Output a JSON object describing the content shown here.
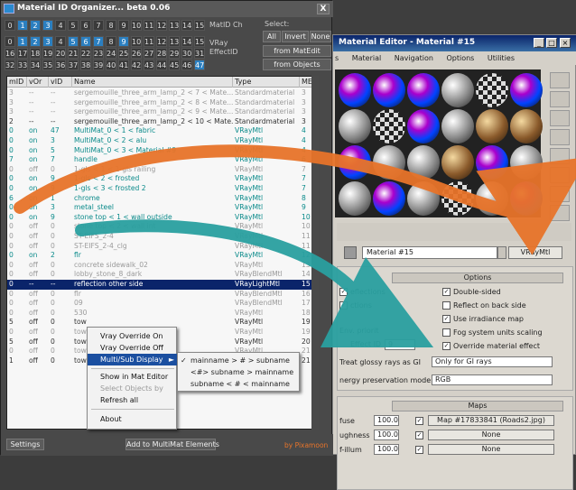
{
  "organizer": {
    "title": "Material ID Organizer...   beta 0.06",
    "close": "X",
    "matid_ch_label": "MatID Ch",
    "vray_label": "VRay",
    "effectid_label": "EffectID",
    "select_label": "Select:",
    "btn_all": "All",
    "btn_invert": "Invert",
    "btn_none": "None",
    "btn_from_matedit": "from MatEdit",
    "btn_from_objects": "from Objects",
    "matid_nums": [
      "0",
      "1",
      "2",
      "3",
      "4",
      "5",
      "6",
      "7",
      "8",
      "9",
      "10",
      "11",
      "12",
      "13",
      "14",
      "15"
    ],
    "matid_active": [
      false,
      true,
      true,
      true,
      false,
      false,
      false,
      false,
      false,
      false,
      false,
      false,
      false,
      false,
      false,
      false
    ],
    "effect_nums_row1": [
      "0",
      "1",
      "2",
      "3",
      "4",
      "5",
      "6",
      "7",
      "8",
      "9",
      "10",
      "11",
      "12",
      "13",
      "14",
      "15"
    ],
    "effect_active_row1": [
      false,
      true,
      true,
      true,
      false,
      true,
      true,
      true,
      false,
      true,
      false,
      false,
      false,
      false,
      false,
      false
    ],
    "effect_nums_row2": [
      "16",
      "17",
      "18",
      "19",
      "20",
      "21",
      "22",
      "23",
      "24",
      "25",
      "26",
      "27",
      "28",
      "29",
      "30",
      "31"
    ],
    "effect_nums_row3": [
      "32",
      "33",
      "34",
      "35",
      "36",
      "37",
      "38",
      "39",
      "40",
      "41",
      "42",
      "43",
      "44",
      "45",
      "46",
      "47"
    ],
    "effect_active_row3": [
      false,
      false,
      false,
      false,
      false,
      false,
      false,
      false,
      false,
      false,
      false,
      false,
      false,
      false,
      false,
      true
    ],
    "columns": [
      "mID",
      "vOr",
      "vID",
      "Name",
      "Type",
      "ME"
    ],
    "rows": [
      {
        "mid": "3",
        "vor": "--",
        "vid": "--",
        "name": "sergemouille_three_arm_lamp_2 < 7 < Mate...",
        "type": "Standardmaterial",
        "me": "3",
        "style": "g"
      },
      {
        "mid": "3",
        "vor": "--",
        "vid": "--",
        "name": "sergemouille_three_arm_lamp_2 < 8 < Mate...",
        "type": "Standardmaterial",
        "me": "3",
        "style": "g"
      },
      {
        "mid": "3",
        "vor": "--",
        "vid": "--",
        "name": "sergemouille_three_arm_lamp_2 < 9 < Mate...",
        "type": "Standardmaterial",
        "me": "3",
        "style": "g"
      },
      {
        "mid": "2",
        "vor": "--",
        "vid": "--",
        "name": "sergemouille_three_arm_lamp_2 < 10 < Mate...",
        "type": "Standardmaterial",
        "me": "3",
        "style": "b"
      },
      {
        "mid": "0",
        "vor": "on",
        "vid": "47",
        "name": "MultiMat_0 < 1 < fabric",
        "type": "VRayMtl",
        "me": "4",
        "style": "t"
      },
      {
        "mid": "0",
        "vor": "on",
        "vid": "3",
        "name": "MultiMat_0 < 2 < alu",
        "type": "VRayMtl",
        "me": "4",
        "style": "t"
      },
      {
        "mid": "0",
        "vor": "on",
        "vid": "5",
        "name": "MultiMat_0 < 3 < Material #9",
        "type": "VRayMtl",
        "me": "4",
        "style": "t"
      },
      {
        "mid": "7",
        "vor": "on",
        "vid": "7",
        "name": "handle",
        "type": "VRayMtl",
        "me": "6",
        "style": "t"
      },
      {
        "mid": "0",
        "vor": "off",
        "vid": "0",
        "name": "1-gls < 1 < 1-gls railing",
        "type": "VRayMtl",
        "me": "7",
        "style": "g"
      },
      {
        "mid": "0",
        "vor": "on",
        "vid": "9",
        "name": "1-gls < 2 < frosted",
        "type": "VRayMtl",
        "me": "7",
        "style": "t"
      },
      {
        "mid": "0",
        "vor": "on",
        "vid": "9",
        "name": "1-gls < 3 < frosted 2",
        "type": "VRayMtl",
        "me": "7",
        "style": "t"
      },
      {
        "mid": "6",
        "vor": "on",
        "vid": "1",
        "name": "chrome",
        "type": "VRayMtl",
        "me": "8",
        "style": "t"
      },
      {
        "mid": "0",
        "vor": "on",
        "vid": "3",
        "name": "metal_steel",
        "type": "VRayMtl",
        "me": "9",
        "style": "t"
      },
      {
        "mid": "0",
        "vor": "on",
        "vid": "9",
        "name": "stone top < 1 < wall outside",
        "type": "VRayMtl",
        "me": "10",
        "style": "t"
      },
      {
        "mid": "0",
        "vor": "off",
        "vid": "0",
        "name": "stone top < 2 < wall int",
        "type": "VRayMtl",
        "me": "10",
        "style": "g"
      },
      {
        "mid": "0",
        "vor": "off",
        "vid": "0",
        "name": "ST-EIFS_2-4",
        "type": "VRayMtl",
        "me": "11",
        "style": "g"
      },
      {
        "mid": "0",
        "vor": "off",
        "vid": "0",
        "name": "ST-EIFS_2-4_clg",
        "type": "VRayMtl",
        "me": "11",
        "style": "g"
      },
      {
        "mid": "0",
        "vor": "on",
        "vid": "2",
        "name": "flr",
        "type": "VRayMtl",
        "me": "12",
        "style": "t"
      },
      {
        "mid": "0",
        "vor": "off",
        "vid": "0",
        "name": "concrete sidewalk_02",
        "type": "VRayMtl",
        "me": "13",
        "style": "g"
      },
      {
        "mid": "0",
        "vor": "off",
        "vid": "0",
        "name": "lobby_stone_8_dark",
        "type": "VRayBlendMtl",
        "me": "14",
        "style": "g"
      },
      {
        "mid": "0",
        "vor": "--",
        "vid": "--",
        "name": "reflection other side",
        "type": "VRayLightMtl",
        "me": "15",
        "style": "sel"
      },
      {
        "mid": "0",
        "vor": "off",
        "vid": "0",
        "name": "flr",
        "type": "VRayBlendMtl",
        "me": "16",
        "style": "g"
      },
      {
        "mid": "0",
        "vor": "off",
        "vid": "0",
        "name": "09",
        "type": "VRayBlendMtl",
        "me": "17",
        "style": "g"
      },
      {
        "mid": "0",
        "vor": "off",
        "vid": "0",
        "name": "530",
        "type": "VRayMtl",
        "me": "18",
        "style": "g"
      },
      {
        "mid": "5",
        "vor": "off",
        "vid": "0",
        "name": "tow",
        "type": "VRayMtl",
        "me": "19",
        "style": "b"
      },
      {
        "mid": "0",
        "vor": "off",
        "vid": "0",
        "name": "tow",
        "type": "VRayMtl",
        "me": "19",
        "style": "g"
      },
      {
        "mid": "5",
        "vor": "off",
        "vid": "0",
        "name": "tow                                   panel - black t...",
        "type": "VRayMtl",
        "me": "20",
        "style": "b"
      },
      {
        "mid": "0",
        "vor": "off",
        "vid": "0",
        "name": "tow",
        "type": "VRayMtl",
        "me": "21",
        "style": "g"
      },
      {
        "mid": "1",
        "vor": "off",
        "vid": "0",
        "name": "tow                                   name",
        "type": "VRayMtl",
        "me": "21",
        "style": "b"
      }
    ],
    "footer_settings": "Settings",
    "footer_add": "Add to MultiMat Elements",
    "footer_credit": "by Pixamoon"
  },
  "context_menu": {
    "items": [
      {
        "label": "Vray Override On",
        "state": "normal"
      },
      {
        "label": "Vray Override Off",
        "state": "normal"
      },
      {
        "label": "Multi/Sub Display",
        "state": "highlight"
      },
      {
        "label": "Show in Mat Editor",
        "state": "normal"
      },
      {
        "label": "Select Objects by",
        "state": "disabled"
      },
      {
        "label": "Refresh all",
        "state": "normal"
      },
      {
        "label": "About",
        "state": "normal"
      }
    ],
    "submenu_arrow": "►",
    "submenu": [
      {
        "label": "mainname > # > subname",
        "checked": true
      },
      {
        "label": "<#> subname > mainname",
        "checked": false
      },
      {
        "label": "subname < # < mainname",
        "checked": false
      }
    ],
    "check_glyph": "✓"
  },
  "mat_editor": {
    "title": "Material Editor - Material #15",
    "win_min": "_",
    "win_max": "□",
    "win_close": "×",
    "menu": [
      "s",
      "Material",
      "Navigation",
      "Options",
      "Utilities"
    ],
    "material_name": "Material #15",
    "material_type": "VRayMtl",
    "options_header": "Options",
    "opt_trace_reflections": "eflections",
    "opt_trace_refractions": "ctions",
    "opt_double_sided": "Double-sided",
    "opt_reflect_back": "Reflect on back side",
    "opt_use_irradiance": "Use irradiance map",
    "opt_fog_units": "Fog system units scaling",
    "opt_override_effect": "Override material effect",
    "env_priority": "Env. priorit",
    "effect_id_label": "Effect ID",
    "effect_id_value": "9",
    "glossy_label": "Treat glossy rays as GI",
    "glossy_value": "Only for GI rays",
    "energy_label": "nergy preservation mode:",
    "energy_value": "RGB",
    "maps_header": "Maps",
    "maps": [
      {
        "name": "fuse",
        "amount": "100.0",
        "map": "Map #17833841 (Roads2.jpg)"
      },
      {
        "name": "ughness",
        "amount": "100.0",
        "map": "None"
      },
      {
        "name": "f-illum",
        "amount": "100.0",
        "map": "None"
      }
    ]
  },
  "colors": {
    "teal": "#0a8a8a",
    "arrow_orange": "#e8742a",
    "arrow_teal": "#2aa0a0",
    "highlight_blue": "#0a246a",
    "id_blue": "#2b7fc0"
  }
}
